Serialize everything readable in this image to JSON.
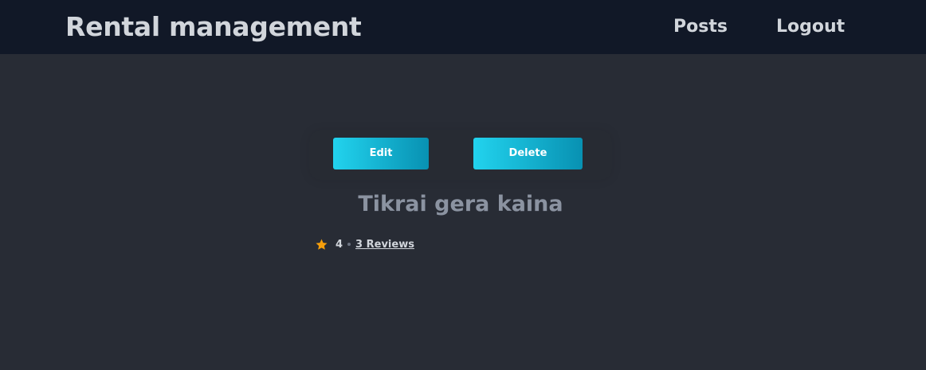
{
  "app": {
    "title": "Rental management"
  },
  "nav": {
    "posts": "Posts",
    "logout": "Logout"
  },
  "actions": {
    "edit": "Edit",
    "delete": "Delete"
  },
  "post": {
    "title": "Tikrai gera kaina",
    "rating": "4",
    "reviews": "3 Reviews"
  },
  "colors": {
    "navbar": "#111827",
    "background": "#282c35",
    "button_start": "#22d3ee",
    "button_end": "#0891b2",
    "star": "#f59e0b"
  },
  "icons": {
    "rating": "star-icon"
  }
}
